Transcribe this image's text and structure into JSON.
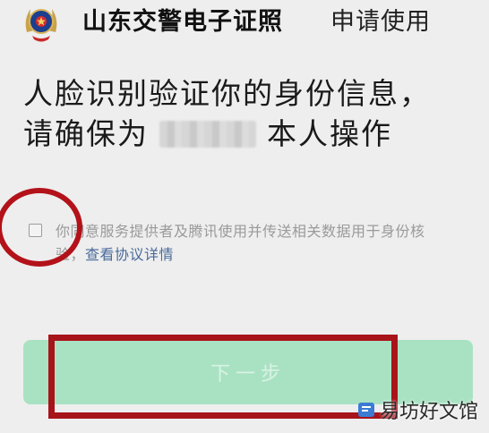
{
  "header": {
    "app_name": "山东交警电子证照",
    "action": "申请使用",
    "logo_icon": "police-emblem-icon"
  },
  "verification": {
    "line1": "人脸识别验证你的身份信息，",
    "line2_prefix": "请确保为",
    "line2_suffix": "本人操作"
  },
  "agreement": {
    "text_line1": "你同意服务提供者及腾讯使用并传送相关数据用于身份核",
    "text_line2_prefix": "验，",
    "link_label": "查看协议详情",
    "checked": false
  },
  "next_button": {
    "label": "下一步",
    "enabled": false
  },
  "watermark": {
    "text": "易坊好文馆"
  },
  "colors": {
    "background": "#eeeeee",
    "button_disabled": "#a9e2c3",
    "link": "#4a6a9a",
    "annotation": "#b3121a"
  }
}
